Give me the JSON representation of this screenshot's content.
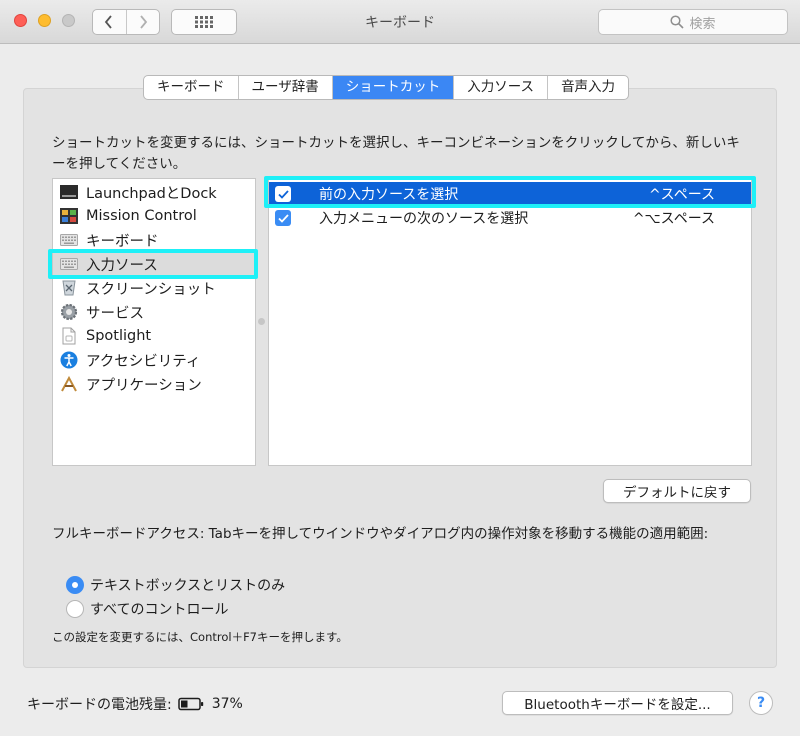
{
  "window": {
    "title": "キーボード"
  },
  "toolbar": {
    "search_placeholder": "検索"
  },
  "tabs": [
    {
      "label": "キーボード",
      "active": false
    },
    {
      "label": "ユーザ辞書",
      "active": false
    },
    {
      "label": "ショートカット",
      "active": true
    },
    {
      "label": "入力ソース",
      "active": false
    },
    {
      "label": "音声入力",
      "active": false
    }
  ],
  "description": "ショートカットを変更するには、ショートカットを選択し、キーコンビネーションをクリックしてから、新しいキーを押してください。",
  "categories": [
    {
      "label": "LaunchpadとDock",
      "icon": "launchpad-dock-icon",
      "selected": false
    },
    {
      "label": "Mission Control",
      "icon": "mission-control-icon",
      "selected": false
    },
    {
      "label": "キーボード",
      "icon": "keyboard-icon",
      "selected": false
    },
    {
      "label": "入力ソース",
      "icon": "keyboard-icon",
      "selected": true
    },
    {
      "label": "スクリーンショット",
      "icon": "screenshot-icon",
      "selected": false
    },
    {
      "label": "サービス",
      "icon": "gear-icon",
      "selected": false
    },
    {
      "label": "Spotlight",
      "icon": "document-icon",
      "selected": false
    },
    {
      "label": "アクセシビリティ",
      "icon": "accessibility-icon",
      "selected": false
    },
    {
      "label": "アプリケーション",
      "icon": "app-store-icon",
      "selected": false
    }
  ],
  "shortcuts": [
    {
      "label": "前の入力ソースを選択",
      "key": "^スペース",
      "checked": true,
      "selected": true
    },
    {
      "label": "入力メニューの次のソースを選択",
      "key": "^⌥スペース",
      "checked": true,
      "selected": false
    }
  ],
  "restore_defaults_label": "デフォルトに戻す",
  "full_keyboard_access": {
    "text": "フルキーボードアクセス: Tabキーを押してウインドウやダイアログ内の操作対象を移動する機能の適用範囲:",
    "options": [
      {
        "label": "テキストボックスとリストのみ",
        "selected": true
      },
      {
        "label": "すべてのコントロール",
        "selected": false
      }
    ],
    "note": "この設定を変更するには、Control＋F7キーを押します。"
  },
  "footer": {
    "battery_label": "キーボードの電池残量:",
    "battery_percent": "37%",
    "bluetooth_button_label": "Bluetoothキーボードを設定...",
    "help_label": "?"
  },
  "colors": {
    "accent": "#3a8cf4",
    "selection": "#0d63d8",
    "highlight": "#1ef0f7"
  }
}
